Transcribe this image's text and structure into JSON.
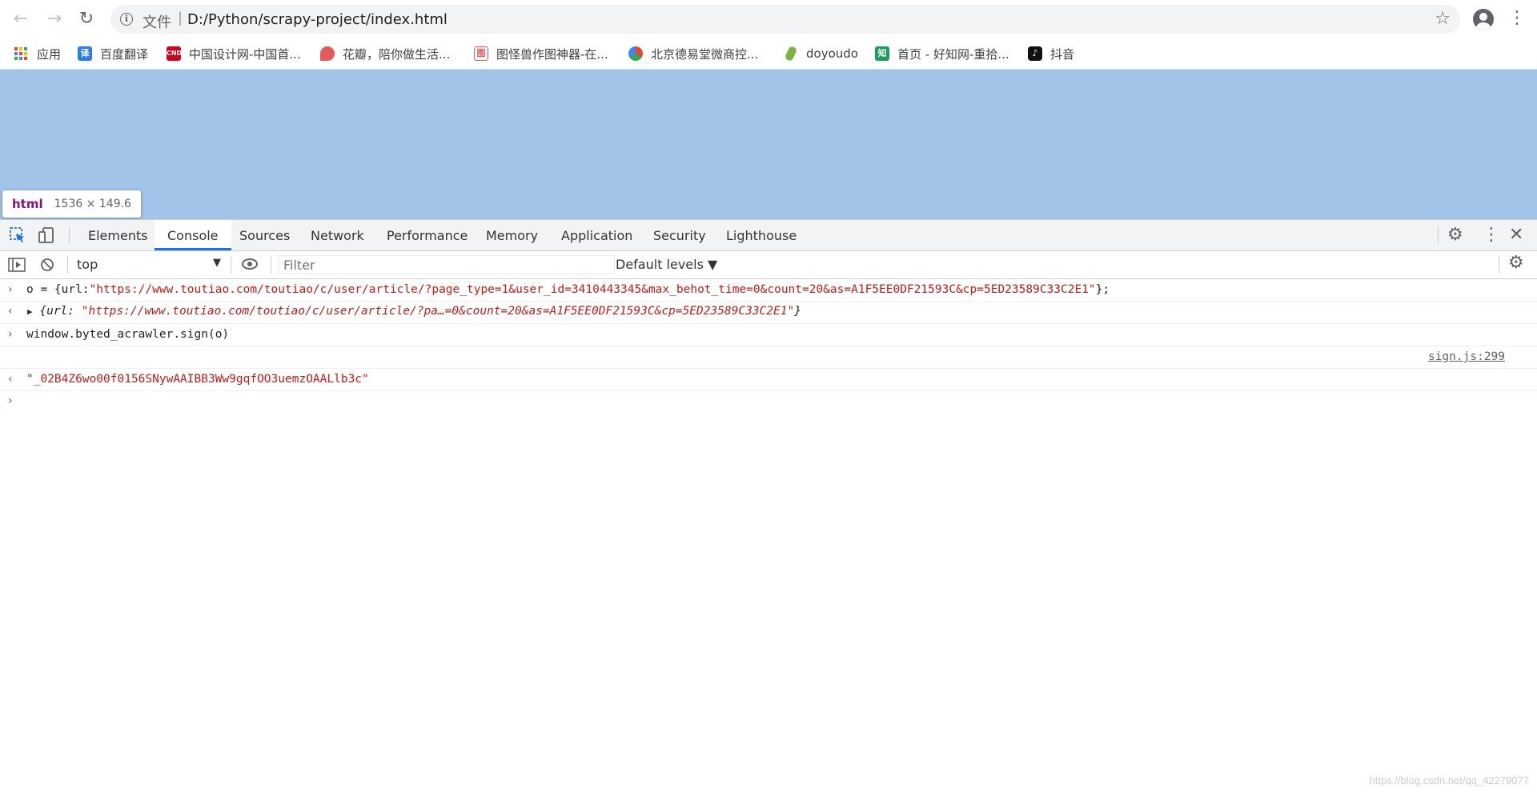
{
  "browser": {
    "back": "←",
    "forward": "→",
    "reload": "↻",
    "scheme_label": "文件",
    "separator": "|",
    "url": "D:/Python/scrapy-project/index.html",
    "star": "☆",
    "menu": "⋮"
  },
  "bookmarks": [
    {
      "label": "应用",
      "icon": "apps-grid-icon"
    },
    {
      "label": "百度翻译",
      "icon": "baidu-translate-icon",
      "icon_text": "译",
      "color": "#2b7de9"
    },
    {
      "label": "中国设计网-中国首...",
      "icon": "cnd-icon",
      "icon_text": "CND",
      "color": "#d0021b"
    },
    {
      "label": "花瓣，陪你做生活...",
      "icon": "huaban-icon",
      "icon_text": "",
      "color": "#e45a5a"
    },
    {
      "label": "图怪兽作图神器-在...",
      "icon": "tuguaishou-icon",
      "icon_text": "图",
      "color": "#ee5454"
    },
    {
      "label": "北京德易堂微商控...",
      "icon": "deyitang-icon",
      "icon_text": "",
      "color": "#3a9f4a"
    },
    {
      "label": "doyoudo",
      "icon": "doyoudo-icon",
      "icon_text": "",
      "color": "#7cb342"
    },
    {
      "label": "首页 - 好知网-重拾...",
      "icon": "haozhi-icon",
      "icon_text": "知",
      "color": "#1a9d5b"
    },
    {
      "label": "抖音",
      "icon": "douyin-icon",
      "icon_text": "♪",
      "color": "#111111"
    }
  ],
  "page": {
    "background": "#a1c4e8",
    "tooltip_tag": "html",
    "tooltip_dims": "1536 × 149.6"
  },
  "devtools": {
    "tabs": [
      "Elements",
      "Console",
      "Sources",
      "Network",
      "Performance",
      "Memory",
      "Application",
      "Security",
      "Lighthouse"
    ],
    "active_tab": "Console",
    "context": "top",
    "filter_placeholder": "Filter",
    "levels": "Default levels ▼"
  },
  "console": {
    "line1_prefix": "o = {url:",
    "line1_string": "\"https://www.toutiao.com/toutiao/c/user/article/?page_type=1&user_id=3410443345&max_behot_time=0&count=20&as=A1F5EE0DF21593C&cp=5ED23589C33C2E1\"",
    "line1_suffix": "};",
    "line2_prefix": "{url: ",
    "line2_string": "\"https://www.toutiao.com/toutiao/c/user/article/?pa…=0&count=20&as=A1F5EE0DF21593C&cp=5ED23589C33C2E1\"",
    "line2_suffix": "}",
    "line3": "window.byted_acrawler.sign(o)",
    "source_link": "sign.js:299",
    "result": "\"_02B4Z6wo00f0156SNywAAIBB3Ww9gqfOO3uemzOAALlb3c\""
  },
  "watermark": "https://blog.csdn.net/qq_42279077"
}
